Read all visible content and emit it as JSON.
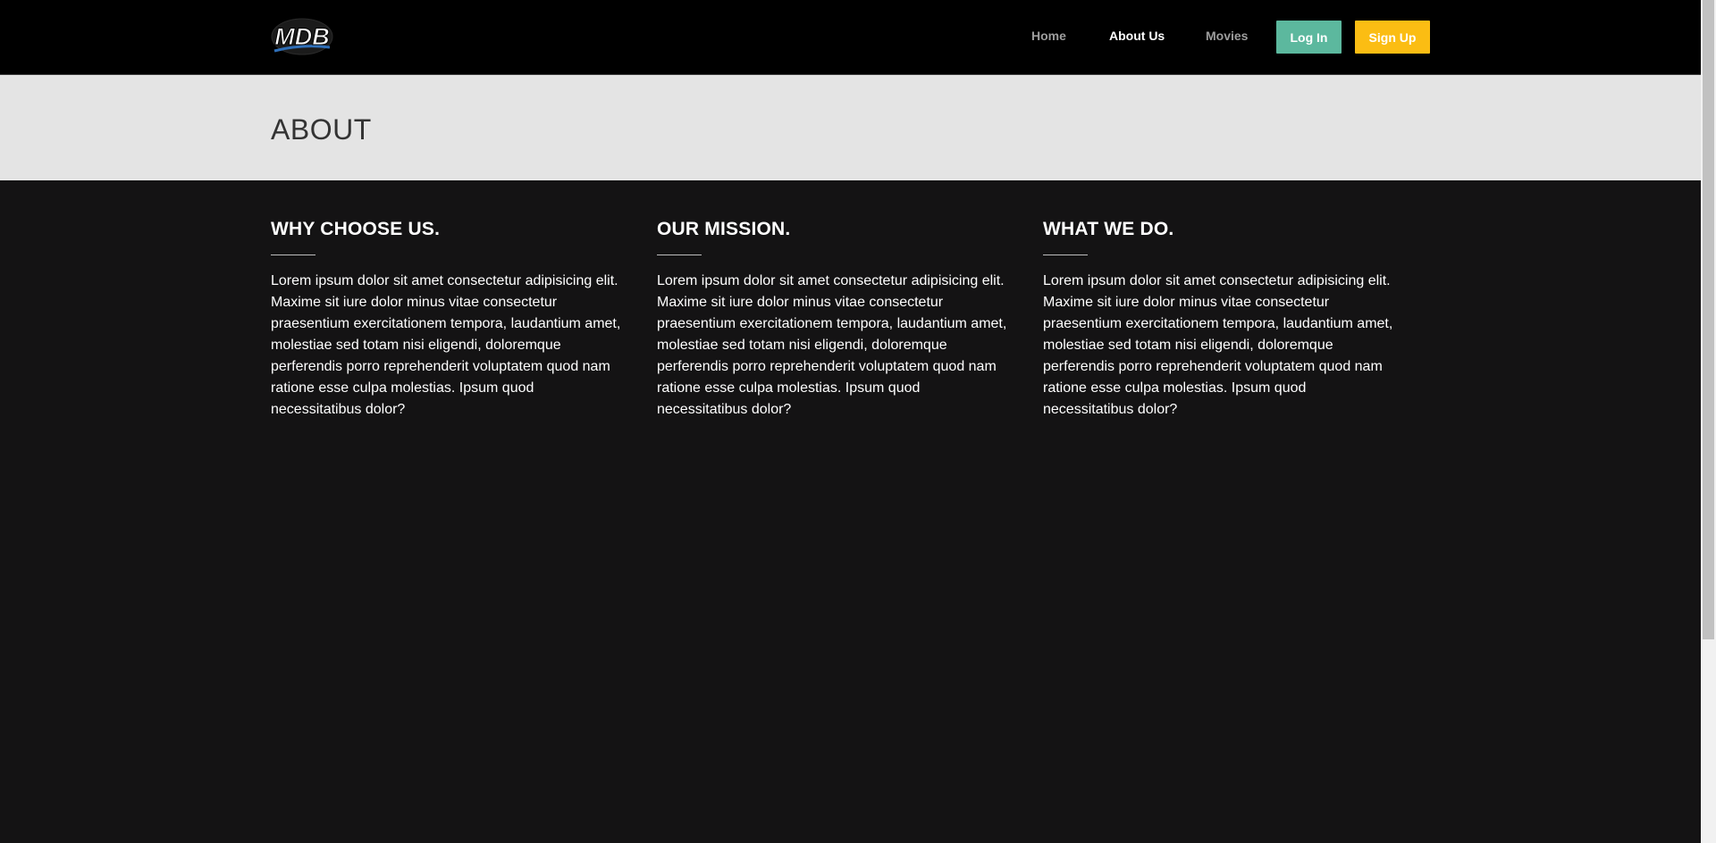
{
  "header": {
    "logo_text": "MDB",
    "nav": {
      "home": "Home",
      "about": "About Us",
      "movies": "Movies"
    },
    "buttons": {
      "login": "Log In",
      "signup": "Sign Up"
    }
  },
  "banner": {
    "title": "ABOUT"
  },
  "columns": [
    {
      "heading": "WHY CHOOSE US.",
      "text": "Lorem ipsum dolor sit amet consectetur adipisicing elit. Maxime sit iure dolor minus vitae consectetur praesentium exercitationem tempora, laudantium amet, molestiae sed totam nisi eligendi, doloremque perferendis porro reprehenderit voluptatem quod nam ratione esse culpa molestias. Ipsum quod necessitatibus dolor?"
    },
    {
      "heading": "OUR MISSION.",
      "text": "Lorem ipsum dolor sit amet consectetur adipisicing elit. Maxime sit iure dolor minus vitae consectetur praesentium exercitationem tempora, laudantium amet, molestiae sed totam nisi eligendi, doloremque perferendis porro reprehenderit voluptatem quod nam ratione esse culpa molestias. Ipsum quod necessitatibus dolor?"
    },
    {
      "heading": "WHAT WE DO.",
      "text": "Lorem ipsum dolor sit amet consectetur adipisicing elit. Maxime sit iure dolor minus vitae consectetur praesentium exercitationem tempora, laudantium amet, molestiae sed totam nisi eligendi, doloremque perferendis porro reprehenderit voluptatem quod nam ratione esse culpa molestias. Ipsum quod necessitatibus dolor?"
    }
  ],
  "colors": {
    "navbar_bg": "#000000",
    "banner_bg": "#e4e4e4",
    "content_bg": "#141314",
    "login_button": "#5cb89e",
    "signup_button": "#fbbd13",
    "nav_link": "#9d9d9d",
    "nav_link_active": "#ffffff"
  }
}
